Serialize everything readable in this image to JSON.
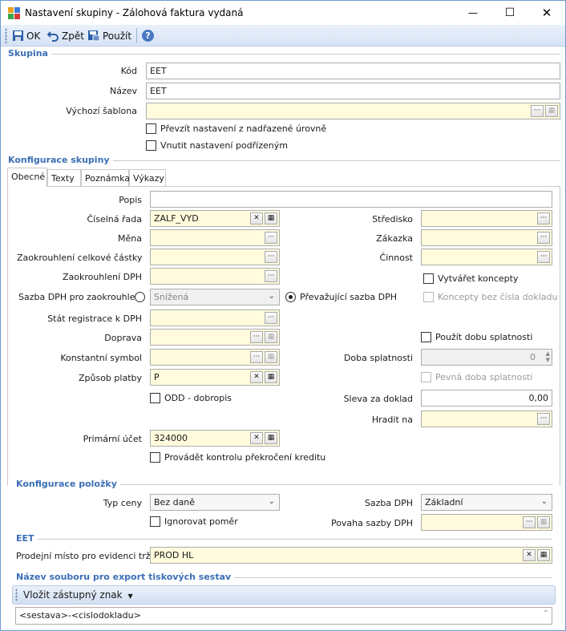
{
  "window": {
    "title": "Nastavení skupiny - Zálohová faktura vydaná",
    "minimize": "—",
    "maximize": "☐",
    "close": "✕"
  },
  "toolbar": {
    "ok_label": "OK",
    "back_label": "Zpět",
    "apply_label": "Použít",
    "help": "?"
  },
  "skupina": {
    "heading": "Skupina",
    "kod_label": "Kód",
    "kod_value": "EET",
    "nazev_label": "Název",
    "nazev_value": "EET",
    "sablona_label": "Výchozí šablona",
    "sablona_value": "",
    "prevzit_label": "Převzít nastavení z nadřazené úrovně",
    "vnutit_label": "Vnutit nastavení podřízeným"
  },
  "konfigurace": {
    "heading": "Konfigurace skupiny",
    "tabs": [
      "Obecné",
      "Texty",
      "Poznámka",
      "Výkazy"
    ]
  },
  "obecne": {
    "popis_label": "Popis",
    "popis_value": "",
    "ciselna_rada_label": "Číselná řada",
    "ciselna_rada_value": "ZALF_VYD",
    "mena_label": "Měna",
    "zaokrouhleni_celk_label": "Zaokrouhlení celkové částky",
    "zaokrouhleni_dph_label": "Zaokrouhlení DPH",
    "sazba_dph_zaokr_label": "Sazba DPH pro zaokrouhlení",
    "snizena_value": "Snížená",
    "prevazujici_label": "Převažující sazba DPH",
    "stat_registrace_label": "Stát registrace k DPH",
    "doprava_label": "Doprava",
    "konst_symbol_label": "Konstantní symbol",
    "zpusob_platby_label": "Způsob platby",
    "zpusob_platby_value": "P",
    "odd_label": "ODD - dobropis",
    "primarni_ucet_label": "Primární účet",
    "primarni_ucet_value": "324000",
    "kontrola_kreditu_label": "Provádět kontrolu překročení kreditu",
    "stredisko_label": "Středisko",
    "zakazka_label": "Zákazka",
    "cinnost_label": "Činnost",
    "vytvaret_koncepty_label": "Vytvářet koncepty",
    "koncepty_bez_cisla_label": "Koncepty bez čísla dokladu",
    "pouzit_dobu_label": "Použít dobu splatnosti",
    "doba_splatnosti_label": "Doba splatnosti",
    "doba_splatnosti_value": "0",
    "pevna_doba_label": "Pevná doba splatnosti",
    "sleva_label": "Sleva za doklad",
    "sleva_value": "0,00",
    "hradit_na_label": "Hradit na"
  },
  "polozky": {
    "heading": "Konfigurace položky",
    "typ_ceny_label": "Typ ceny",
    "typ_ceny_value": "Bez daně",
    "ignorovat_label": "Ignorovat poměr",
    "sazba_dph_label": "Sazba DPH",
    "sazba_dph_value": "Základní",
    "povaha_label": "Povaha sazby DPH"
  },
  "eet": {
    "heading": "EET",
    "prodejni_misto_label": "Prodejní místo pro evidenci tržeb",
    "prodejni_misto_value": "PROD HL"
  },
  "export": {
    "heading": "Název souboru pro export tiskových sestav",
    "vlozit_label": "Vložit zástupný znak",
    "template_value": "<sestava>-<cislodokladu>"
  }
}
